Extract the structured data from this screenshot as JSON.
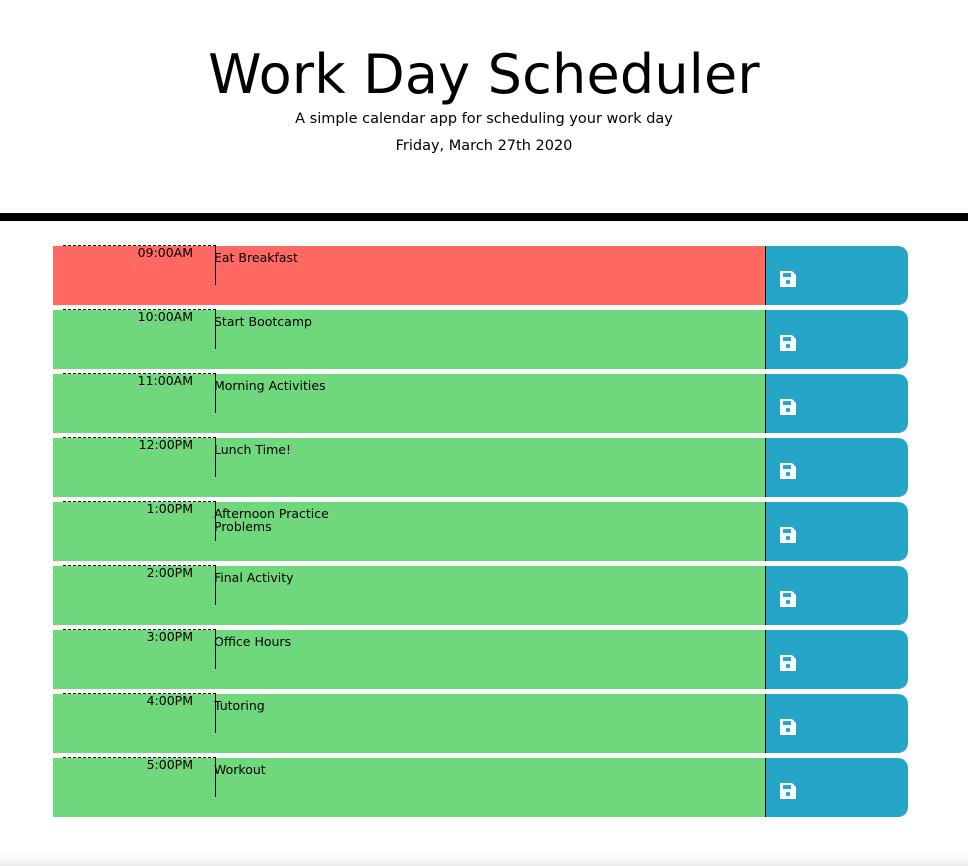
{
  "header": {
    "title": "Work Day Scheduler",
    "subtitle": "A simple calendar app for scheduling your work day",
    "date": "Friday, March 27th 2020"
  },
  "colors": {
    "past": "#ff6961",
    "future": "#6fd77c",
    "save": "#26a5c9"
  },
  "rows": [
    {
      "hour": "09:00AM",
      "text": "Eat Breakfast",
      "state": "present"
    },
    {
      "hour": "10:00AM",
      "text": "Start Bootcamp",
      "state": "future"
    },
    {
      "hour": "11:00AM",
      "text": "Morning Activities",
      "state": "future"
    },
    {
      "hour": "12:00PM",
      "text": "Lunch Time!",
      "state": "future"
    },
    {
      "hour": "1:00PM",
      "text": "Afternoon Practice\nProblems",
      "state": "future"
    },
    {
      "hour": "2:00PM",
      "text": "Final Activity",
      "state": "future"
    },
    {
      "hour": "3:00PM",
      "text": "Office Hours",
      "state": "future"
    },
    {
      "hour": "4:00PM",
      "text": "Tutoring",
      "state": "future"
    },
    {
      "hour": "5:00PM",
      "text": "Workout",
      "state": "future"
    }
  ],
  "save_icon": "floppy-disk-icon"
}
